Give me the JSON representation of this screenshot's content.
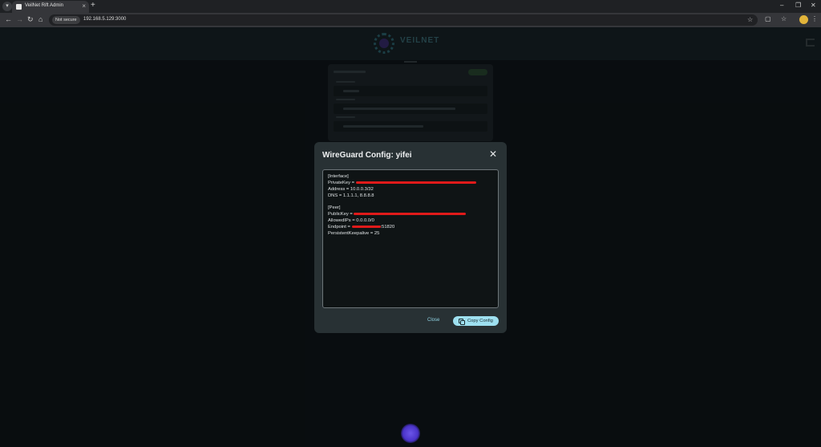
{
  "browser": {
    "tab_title": "VeilNet Rift Admin",
    "not_secure": "Not secure",
    "url": "192.168.5.129:3000"
  },
  "header": {
    "logo_text": "VEILNET"
  },
  "dialog": {
    "title": "WireGuard Config: yifei",
    "close_label": "Close",
    "copy_label": "Copy Config",
    "config": {
      "interface_header": "[Interface]",
      "private_key_label": "PrivateKey = ",
      "address": "Address = 10.0.0.3/32",
      "dns": "DNS = 1.1.1.1, 8.8.8.8",
      "peer_header": "[Peer]",
      "public_key_label": "PublicKey = ",
      "allowed_ips": "AllowedIPs = 0.0.0.0/0",
      "endpoint_label": "Endpoint = ",
      "endpoint_port": ":51820",
      "keepalive": "PersistentKeepalive = 25"
    }
  },
  "colors": {
    "accent": "#9ee0f0",
    "redaction": "#e01a1a",
    "spinner": "#5a44d8"
  }
}
